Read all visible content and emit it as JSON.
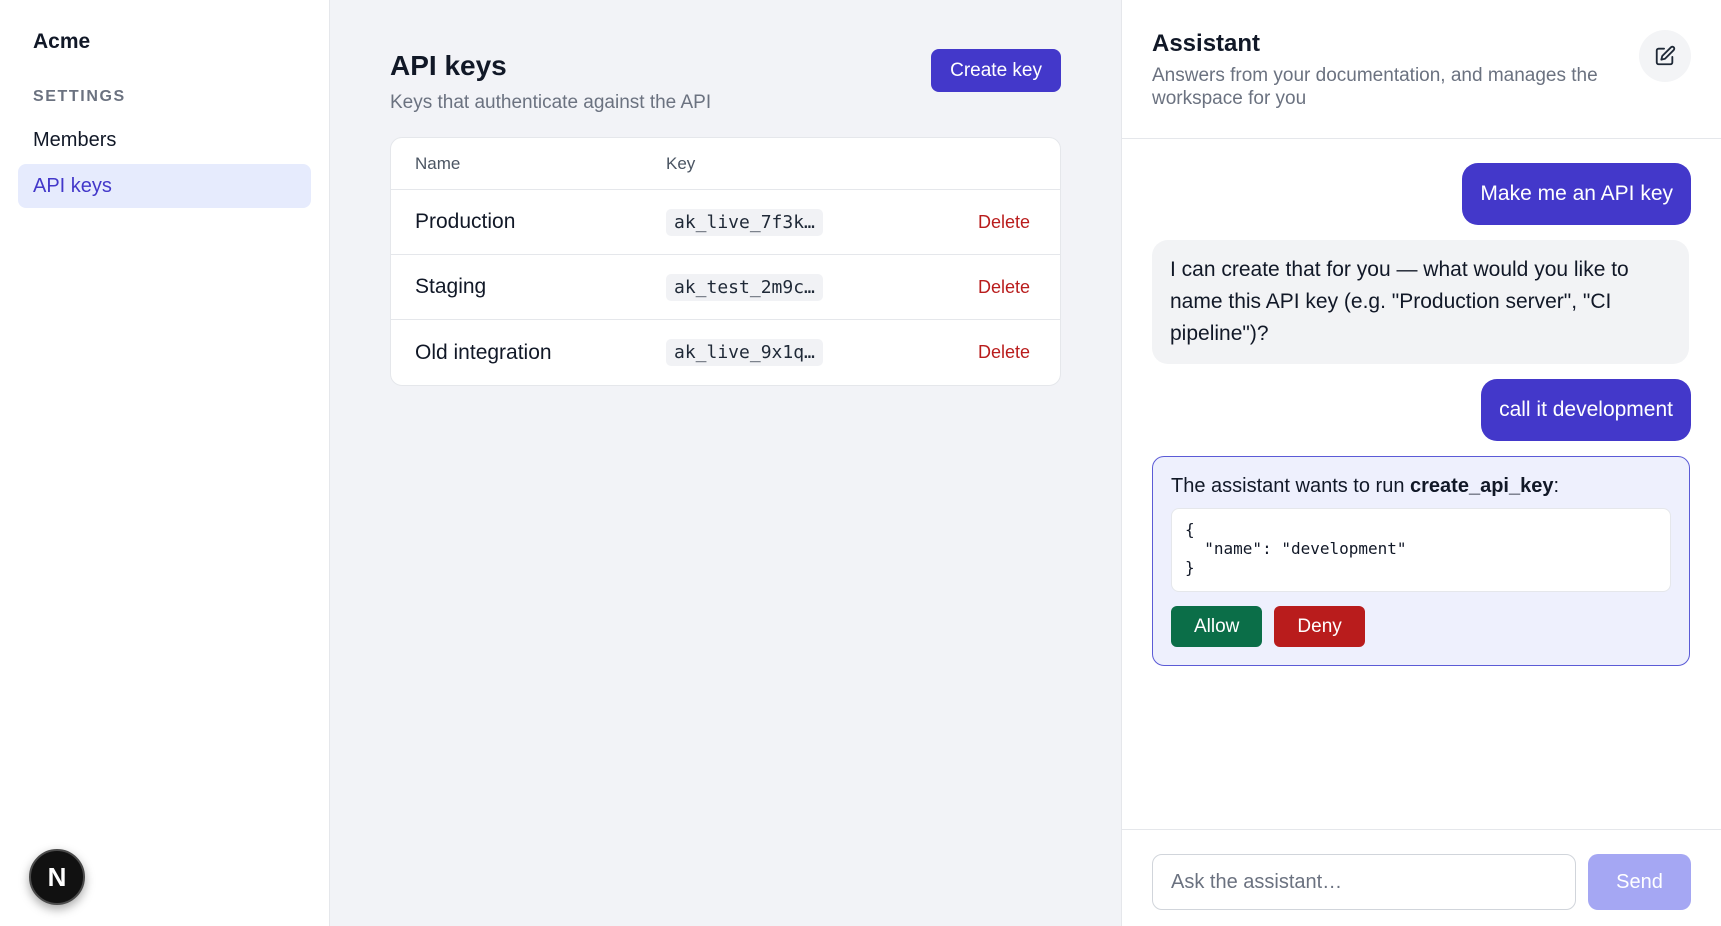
{
  "sidebar": {
    "brand": "Acme",
    "section_label": "SETTINGS",
    "items": [
      {
        "label": "Members",
        "active": false
      },
      {
        "label": "API keys",
        "active": true
      }
    ],
    "badge_letter": "N"
  },
  "main": {
    "title": "API keys",
    "subtitle": "Keys that authenticate against the API",
    "create_label": "Create key",
    "columns": [
      "Name",
      "Key"
    ],
    "rows": [
      {
        "name": "Production",
        "key": "ak_live_7f3k…",
        "action": "Delete"
      },
      {
        "name": "Staging",
        "key": "ak_test_2m9c…",
        "action": "Delete"
      },
      {
        "name": "Old integration",
        "key": "ak_live_9x1q…",
        "action": "Delete"
      }
    ]
  },
  "assistant": {
    "title": "Assistant",
    "subtitle": "Answers from your documentation, and manages the workspace for you",
    "messages": [
      {
        "role": "user",
        "text": "Make me an API key"
      },
      {
        "role": "assistant",
        "text": "I can create that for you — what would you like to name this API key (e.g. \"Production server\", \"CI pipeline\")?"
      },
      {
        "role": "user",
        "text": "call it development"
      }
    ],
    "tool": {
      "prefix": "The assistant wants to run ",
      "name": "create_api_key",
      "suffix": ":",
      "args": "{\n  \"name\": \"development\"\n}",
      "allow_label": "Allow",
      "deny_label": "Deny"
    },
    "composer": {
      "placeholder": "Ask the assistant…",
      "send_label": "Send"
    }
  },
  "colors": {
    "accent": "#4338ca",
    "danger": "#b91c1c",
    "success": "#0b6e48"
  }
}
